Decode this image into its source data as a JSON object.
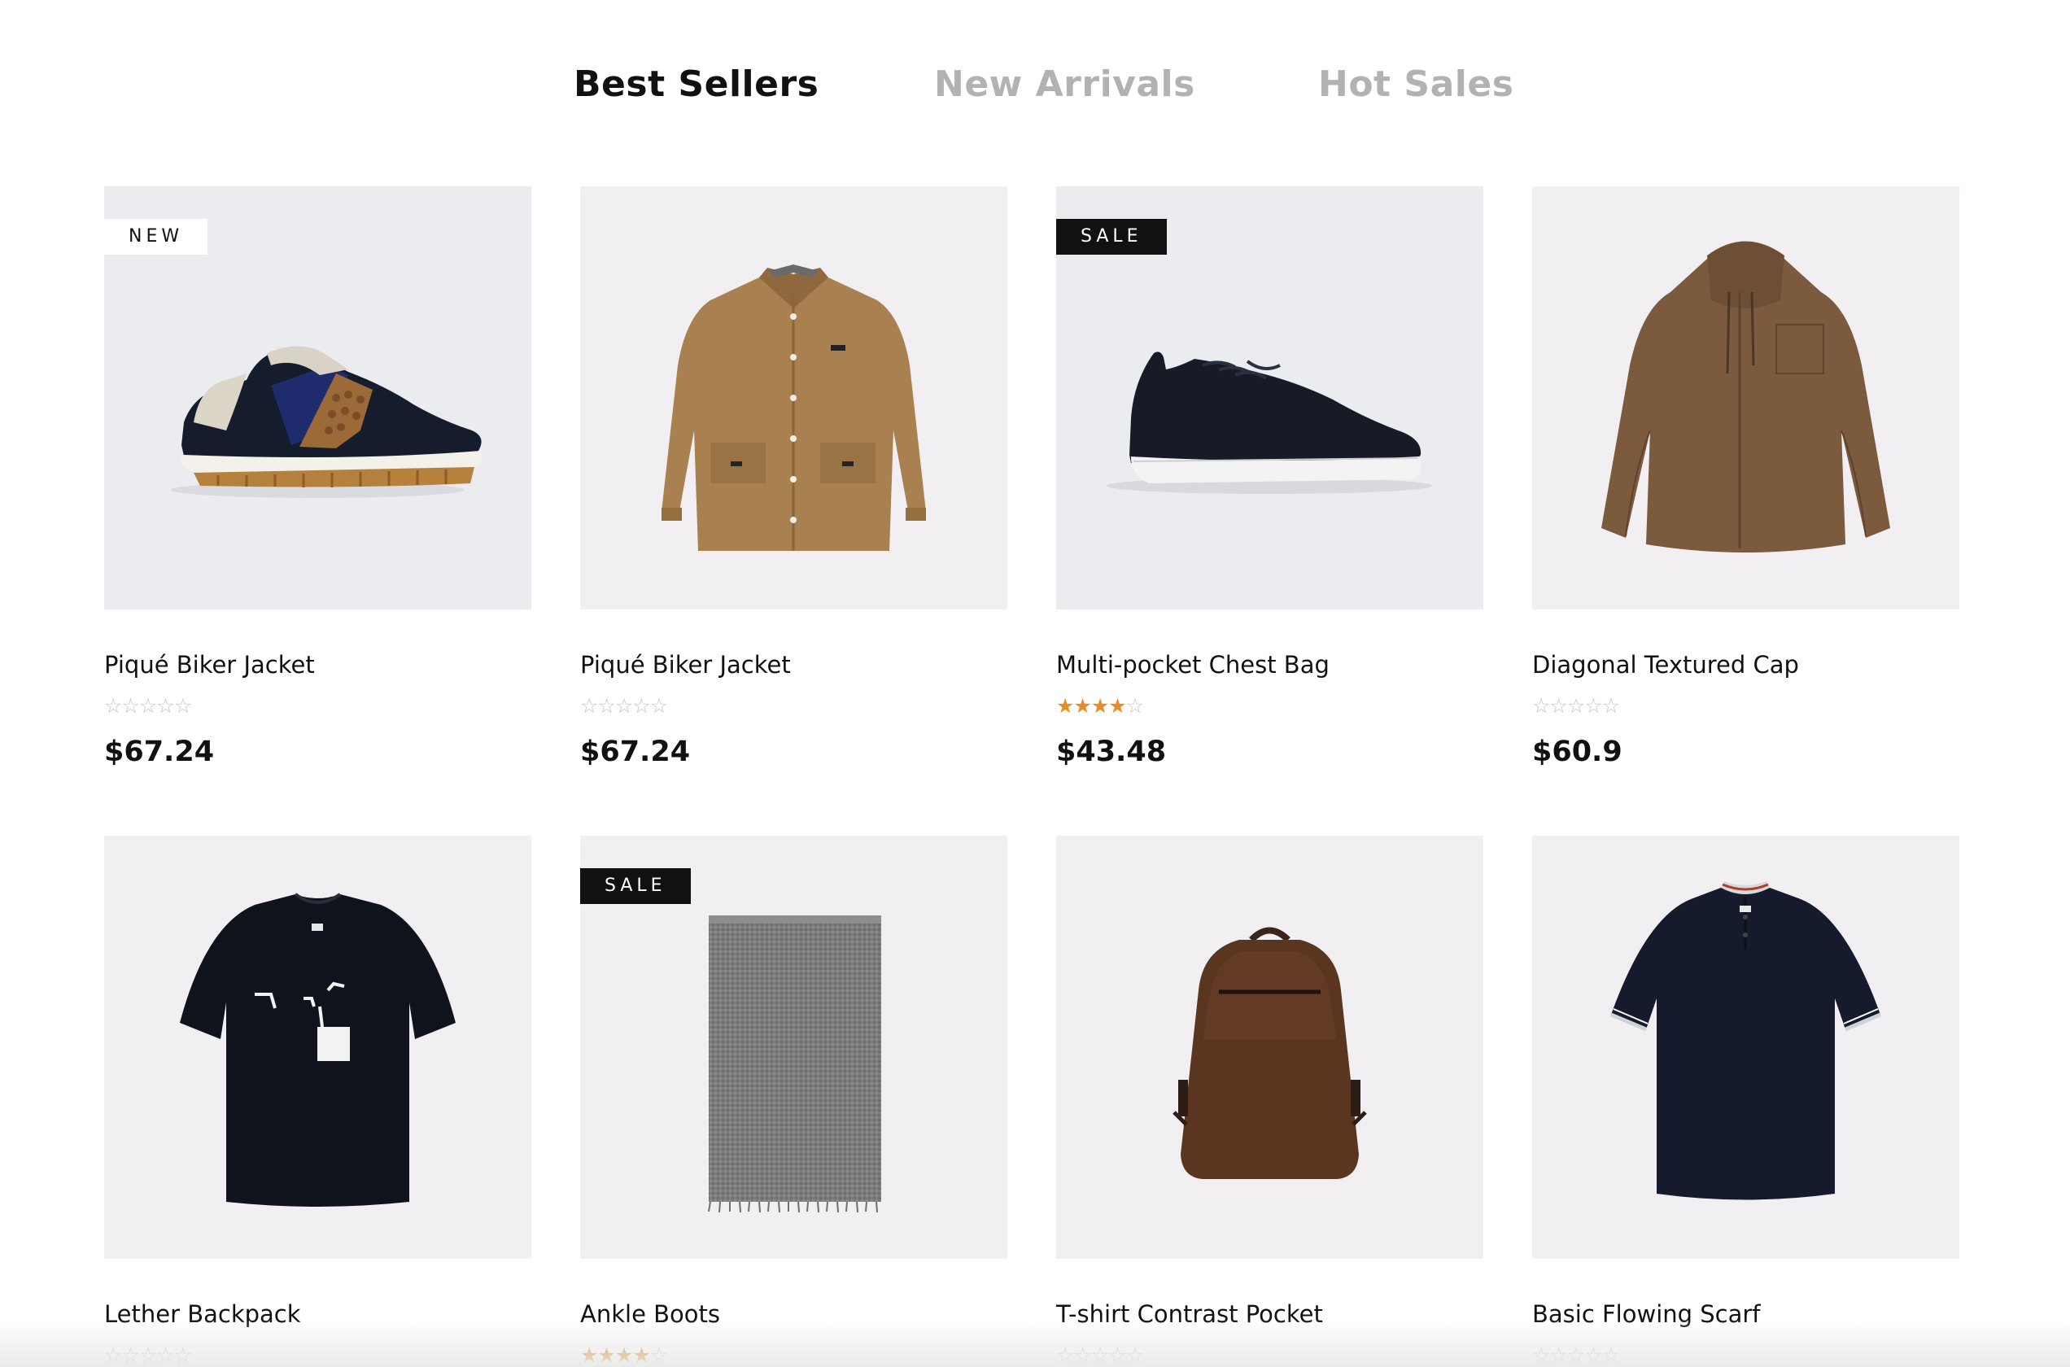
{
  "tabs": [
    {
      "label": "Best Sellers",
      "active": true
    },
    {
      "label": "New Arrivals",
      "active": false
    },
    {
      "label": "Hot Sales",
      "active": false
    }
  ],
  "colors": {
    "active_tab": "#111111",
    "inactive_tab": "#b2b2b2",
    "rating_star": "#e58e27",
    "empty_star": "#c4c4c4",
    "sale_badge": "#111111",
    "image_background": "#f1eff2"
  },
  "products": [
    {
      "name": "Piqué Biker Jacket",
      "price": "$67.24",
      "rating": 0,
      "badge": "NEW",
      "image": "sneaker-navy-brown"
    },
    {
      "name": "Piqué Biker Jacket",
      "price": "$67.24",
      "rating": 0,
      "badge": "",
      "image": "camel-jacket"
    },
    {
      "name": "Multi-pocket Chest Bag",
      "price": "$43.48",
      "rating": 4,
      "badge": "SALE",
      "image": "black-sneaker"
    },
    {
      "name": "Diagonal Textured Cap",
      "price": "$60.9",
      "rating": 0,
      "badge": "",
      "image": "brown-hooded-overshirt"
    },
    {
      "name": "Lether Backpack",
      "price": "",
      "rating": 0,
      "badge": "",
      "image": "black-graphic-tshirt"
    },
    {
      "name": "Ankle Boots",
      "price": "",
      "rating": 4,
      "badge": "SALE",
      "image": "grey-scarf"
    },
    {
      "name": "T-shirt Contrast Pocket",
      "price": "",
      "rating": 0,
      "badge": "",
      "image": "brown-leather-backpack"
    },
    {
      "name": "Basic Flowing Scarf",
      "price": "",
      "rating": 0,
      "badge": "",
      "image": "navy-polo-shirt"
    }
  ]
}
